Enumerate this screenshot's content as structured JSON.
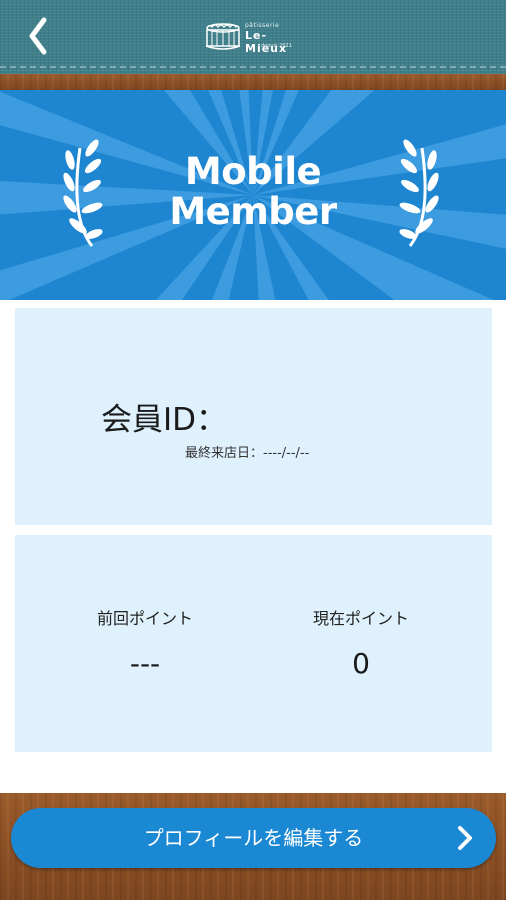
{
  "header": {
    "back_icon": "chevron-left-icon",
    "logo": {
      "small_text": "pâtisserie",
      "name": "Le-Mieux",
      "sub_text": "depuis 2021"
    }
  },
  "banner": {
    "title_line1": "Mobile",
    "title_line2": "Member",
    "color": "#1e86d0",
    "decoration_icon": "laurel-icon"
  },
  "member_card": {
    "id_label": "会員ID：",
    "last_visit_label": "最終来店日：",
    "last_visit_value": "----/--/--"
  },
  "points_card": {
    "previous_label": "前回ポイント",
    "previous_value": "---",
    "current_label": "現在ポイント",
    "current_value": "0"
  },
  "profile_button": {
    "label": "プロフィールを編集する",
    "icon": "chevron-right-icon",
    "color": "#1a88d3"
  }
}
